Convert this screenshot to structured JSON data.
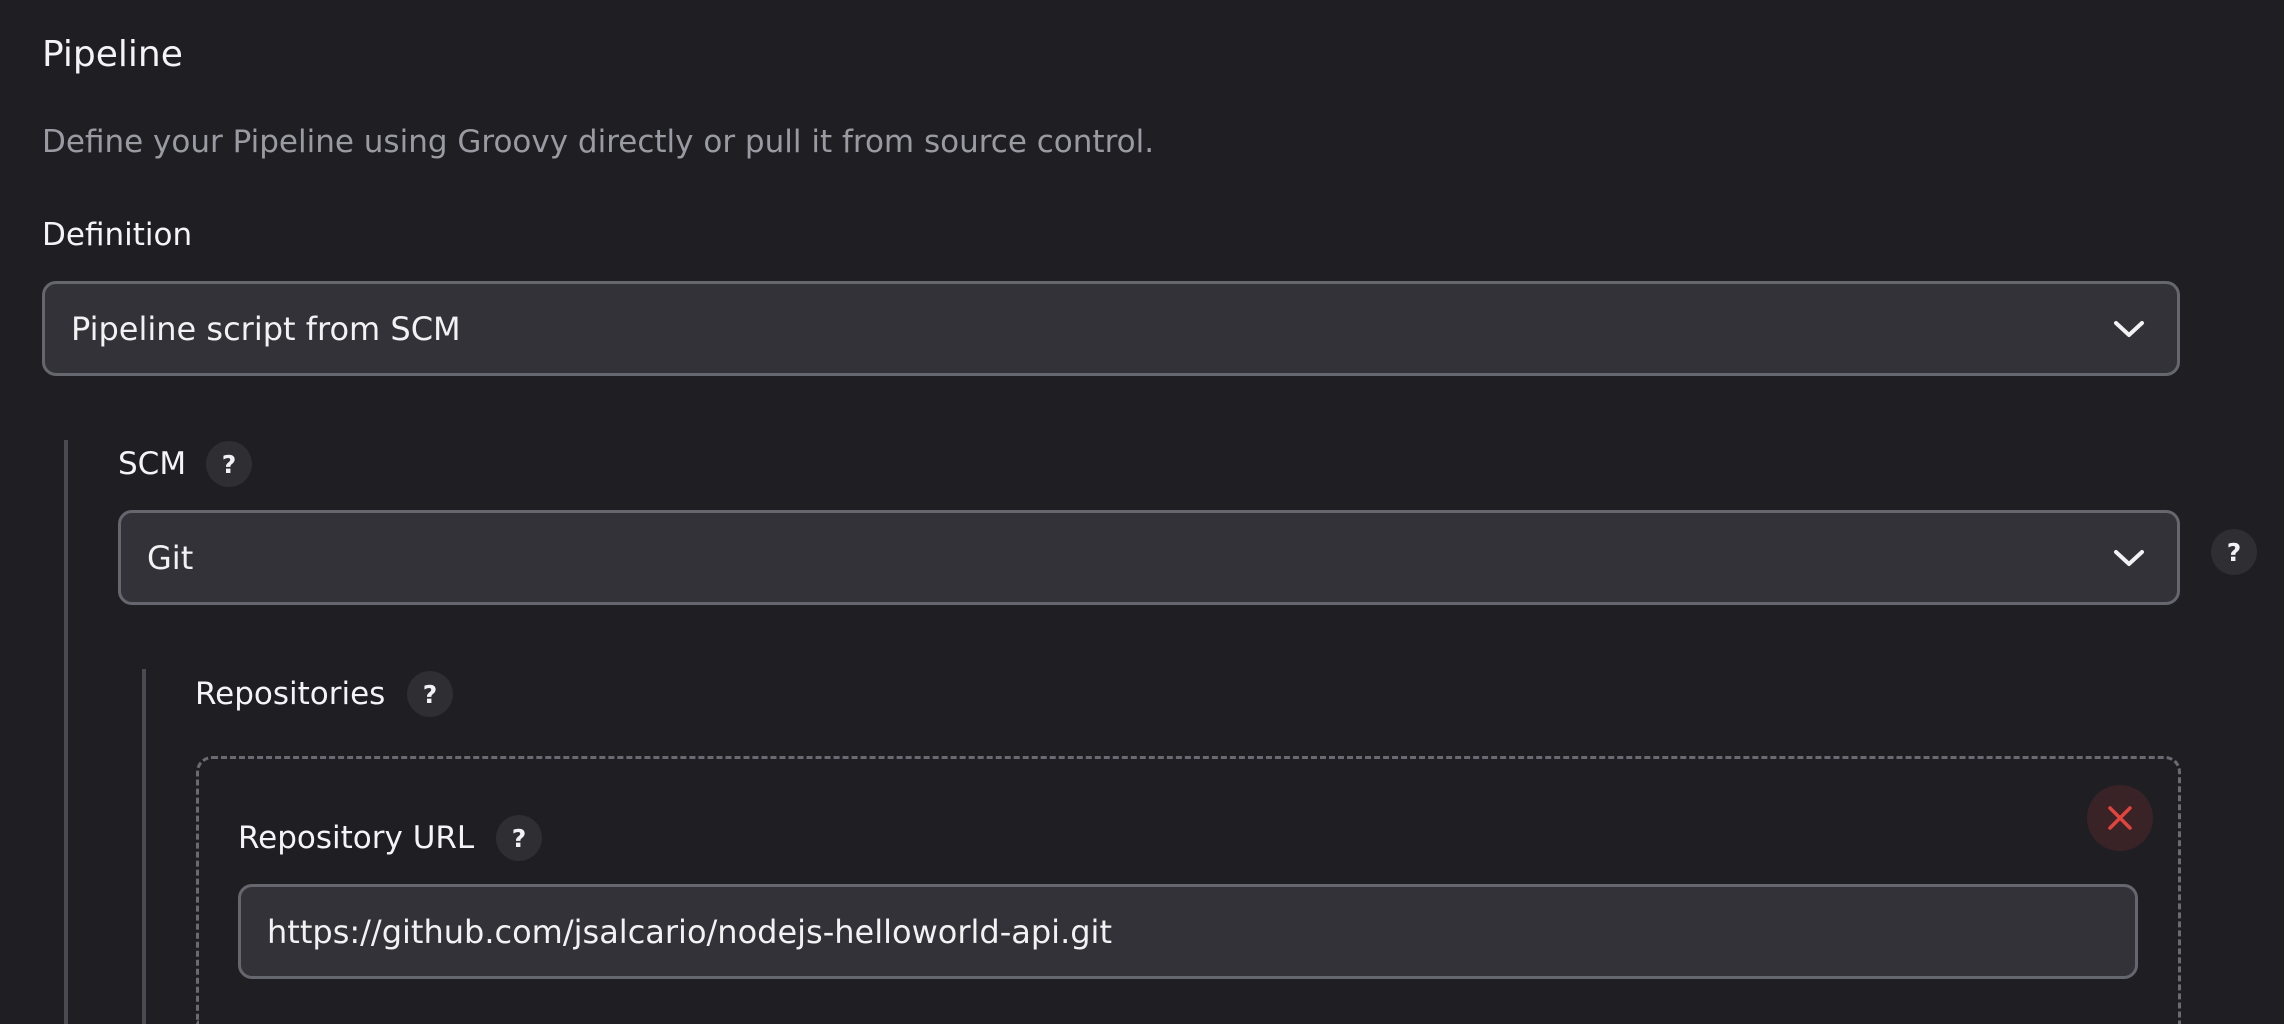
{
  "section": {
    "title": "Pipeline",
    "description": "Define your Pipeline using Groovy directly or pull it from source control."
  },
  "definition": {
    "label": "Definition",
    "selected": "Pipeline script from SCM"
  },
  "scm": {
    "label": "SCM",
    "help": "?",
    "selected": "Git",
    "select_help": "?"
  },
  "repositories": {
    "label": "Repositories",
    "help": "?",
    "repository_url": {
      "label": "Repository URL",
      "help": "?",
      "value": "https://github.com/jsalcario/nodejs-helloworld-api.git"
    }
  },
  "colors": {
    "background": "#1f1f23",
    "input_background": "#323238",
    "border": "#66666e",
    "danger": "#e0443c"
  },
  "icons": {
    "dropdown": "chevron-down-icon",
    "delete": "close-icon"
  }
}
